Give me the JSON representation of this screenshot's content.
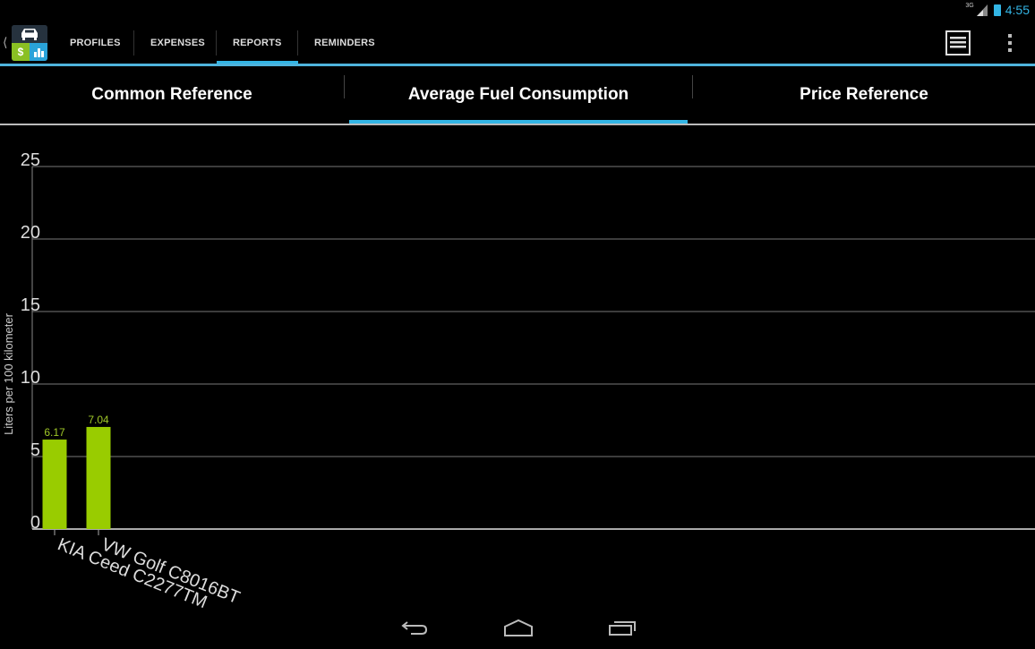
{
  "status_bar": {
    "network": "3G",
    "time": "4:55"
  },
  "action_bar": {
    "app_icon": "car-expense-app-icon",
    "tabs": [
      {
        "label": "PROFILES",
        "active": false
      },
      {
        "label": "EXPENSES",
        "active": false
      },
      {
        "label": "REPORTS",
        "active": true
      },
      {
        "label": "REMINDERS",
        "active": false
      }
    ],
    "actions": [
      "list-menu-icon",
      "overflow-menu-icon"
    ]
  },
  "report_tabs": [
    {
      "label": "Common Reference",
      "active": false
    },
    {
      "label": "Average Fuel Consumption",
      "active": true
    },
    {
      "label": "Price Reference",
      "active": false
    }
  ],
  "colors": {
    "accent": "#33b5e5",
    "bar": "#99cc00",
    "value_label": "#a0c828"
  },
  "chart_data": {
    "type": "bar",
    "title": "",
    "xlabel": "",
    "ylabel": "Liters per 100 kilometer",
    "categories": [
      "KIA Ceed C2277TM",
      "VW Golf C8016BT"
    ],
    "values": [
      6.17,
      7.04
    ],
    "value_labels": [
      "6.17",
      "7.04"
    ],
    "ylim": [
      0,
      25
    ],
    "yticks": [
      0,
      5,
      10,
      15,
      20,
      25
    ],
    "ytick_labels": [
      "0",
      "5",
      "10",
      "15",
      "20",
      "25"
    ],
    "grid": true,
    "legend": "none"
  },
  "nav_bar": {
    "buttons": [
      "back-icon",
      "home-icon",
      "recent-apps-icon"
    ]
  }
}
